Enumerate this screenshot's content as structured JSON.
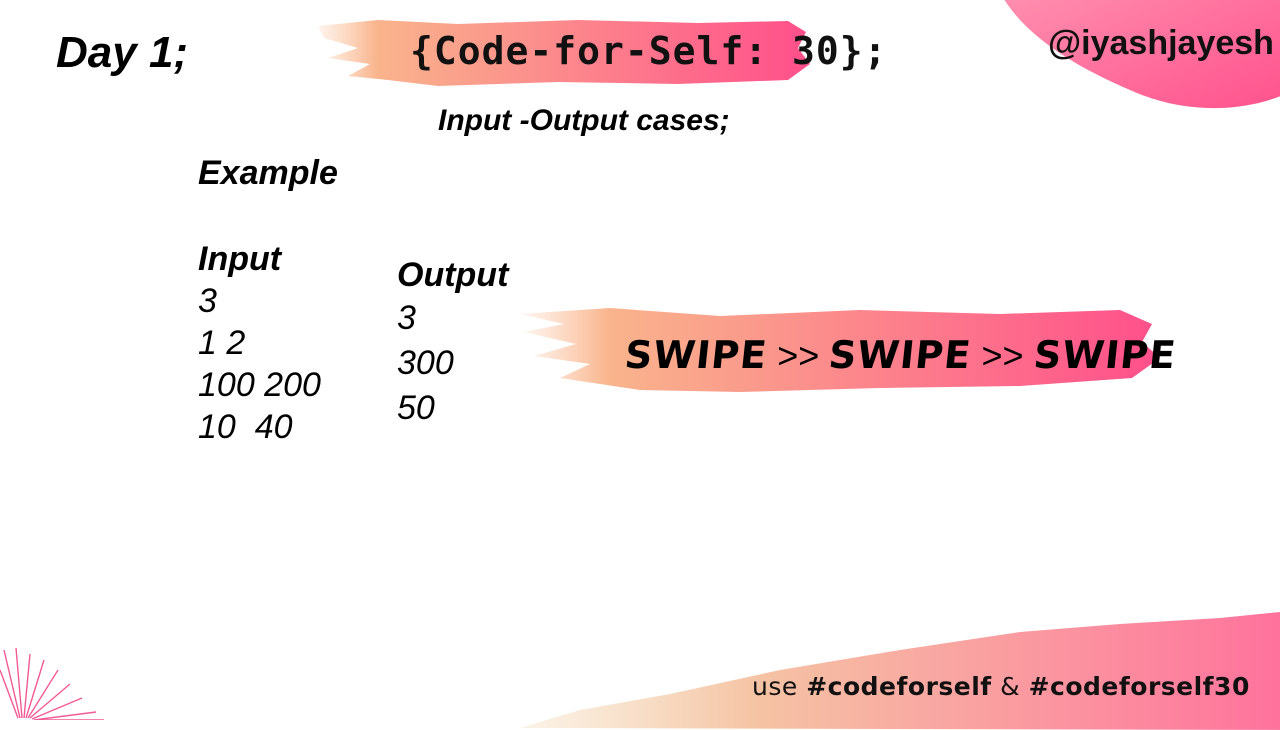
{
  "header": {
    "day": "Day 1;",
    "title": "{Code-for-Self: 30};",
    "handle": "@iyashjayesh"
  },
  "subtitle": "Input -Output cases;",
  "example_label": "Example",
  "input": {
    "heading": "Input",
    "lines": [
      "3",
      "1 2",
      "100 200",
      "10  40"
    ]
  },
  "output": {
    "heading": "Output",
    "lines": [
      "3",
      "300",
      "50"
    ]
  },
  "swipe": {
    "word1": "SWIPE",
    "sep1": ">>",
    "word2": "SWIPE",
    "sep2": ">>",
    "word3": "SWIPE"
  },
  "footer": {
    "prefix": "use",
    "tag1": "#codeforself",
    "amp": "&",
    "tag2": "#codeforself30"
  },
  "colors": {
    "brush_start": "#f9b48c",
    "brush_end": "#ff4f8b",
    "footer_brush_start": "#f3d6b0",
    "footer_brush_end": "#ff6f9c",
    "burst": "#f25a96"
  }
}
